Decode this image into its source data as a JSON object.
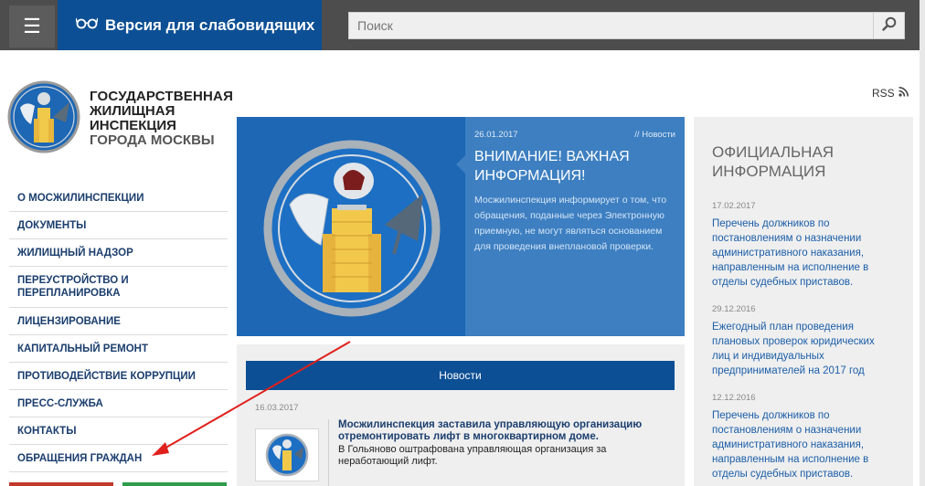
{
  "header": {
    "menu_icon": "hamburger-icon",
    "vision_label": "Версия для слабовидящих",
    "vision_icon": "glasses-icon",
    "search_placeholder": "Поиск",
    "search_icon": "search-icon"
  },
  "logo": {
    "line1": "ГОСУДАРСТВЕННАЯ",
    "line2": "ЖИЛИЩНАЯ",
    "line3": "ИНСПЕКЦИЯ",
    "line4": "ГОРОДА МОСКВЫ"
  },
  "sidebar": {
    "items": [
      {
        "label": "О МОСЖИЛИНСПЕКЦИИ"
      },
      {
        "label": "ДОКУМЕНТЫ"
      },
      {
        "label": "ЖИЛИЩНЫЙ НАДЗОР"
      },
      {
        "label": "ПЕРЕУСТРОЙСТВО И ПЕРЕПЛАНИРОВКА"
      },
      {
        "label": "ЛИЦЕНЗИРОВАНИЕ"
      },
      {
        "label": "КАПИТАЛЬНЫЙ РЕМОНТ"
      },
      {
        "label": "ПРОТИВОДЕЙСТВИЕ КОРРУПЦИИ"
      },
      {
        "label": "ПРЕСС-СЛУЖБА"
      },
      {
        "label": "КОНТАКТЫ"
      },
      {
        "label": "ОБРАЩЕНИЯ ГРАЖДАН"
      }
    ]
  },
  "rss": {
    "label": "RSS",
    "icon": "rss-icon"
  },
  "slide": {
    "date": "26.01.2017",
    "category": "// Новости",
    "title": "ВНИМАНИЕ! ВАЖНАЯ ИНФОРМАЦИЯ!",
    "body": "Мосжилинспекция информирует о том, что обращения, поданные через Электронную приемную, не могут являться основанием для проведения внеплановой проверки."
  },
  "news": {
    "tab_label": "Новости",
    "items": [
      {
        "date": "16.03.2017",
        "title": "Мосжилинспекция заставила управляющую организацию отремонтировать лифт в многоквартирном доме.",
        "text": "В Гольяново оштрафована управляющая организация за неработающий лифт."
      }
    ]
  },
  "official": {
    "heading": "ОФИЦИАЛЬНАЯ ИНФОРМАЦИЯ",
    "entries": [
      {
        "date": "17.02.2017",
        "text": "Перечень должников по постановлениям о назначении административного наказания, направленным на исполнение в отделы судебных приставов."
      },
      {
        "date": "29.12.2016",
        "text": "Ежегодный план проведения плановых проверок юридических лиц и индивидуальных предпринимателей на 2017 год"
      },
      {
        "date": "12.12.2016",
        "text": "Перечень должников по постановлениям о назначении административного наказания, направленным на исполнение в отделы судебных приставов."
      }
    ]
  },
  "colors": {
    "topbar": "#4d4d4d",
    "brand_blue": "#0c4f94",
    "slide_blue": "#3d7fc1",
    "link_blue": "#1b5ea8",
    "annotation_red": "#e0201c"
  }
}
